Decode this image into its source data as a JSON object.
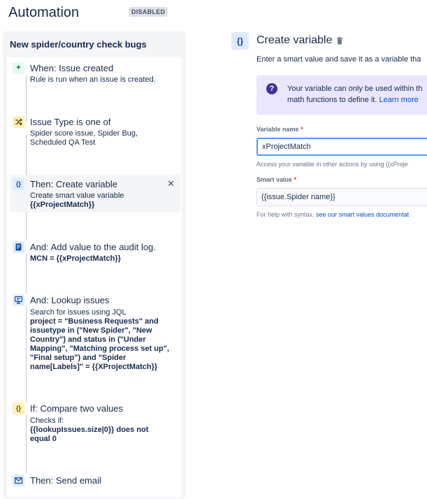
{
  "header": {
    "title": "Automation",
    "status_badge": "DISABLED"
  },
  "rule": {
    "name": "New spider/country check bugs",
    "components": [
      {
        "icon": "plus-icon",
        "title": "When: Issue created",
        "description": "Rule is run when an issue is created.",
        "bold": ""
      },
      {
        "icon": "shuffle-icon",
        "title": "Issue Type is one of",
        "description": "Spider score issue, Spider Bug, Scheduled QA Test",
        "bold": ""
      },
      {
        "icon": "braces-icon",
        "title": "Then: Create variable",
        "description": "Create smart value variable",
        "bold": "{{xProjectMatch}}",
        "selected": true
      },
      {
        "icon": "document-icon",
        "title": "And: Add value to the audit log.",
        "description": "",
        "bold": "MCN = {{xProjectMatch}}"
      },
      {
        "icon": "search-issues-icon",
        "title": "And: Lookup issues",
        "description": "Search for issues using JQL",
        "bold": "project = \"Business Requests\" and issuetype in (\"New Spider\", \"New Country\") and status in (\"Under Mapping\", \"Matching process set up\", \"Final setup\") and \"Spider name[Labels]\" = {{XProjectMatch}}"
      },
      {
        "icon": "braces-icon",
        "title": "If: Compare two values",
        "description": "Checks if:",
        "bold": "{{lookupIssues.size|0}} does not equal 0"
      },
      {
        "icon": "email-icon",
        "title": "Then: Send email",
        "description": "",
        "bold": ""
      }
    ],
    "close_symbol": "✕"
  },
  "editor": {
    "icon_glyph": "{}",
    "title": "Create variable",
    "subtitle": "Enter a smart value and save it as a variable tha",
    "info": {
      "line1": "Your variable can only be used within th",
      "line2_prefix": "math functions to define it. ",
      "line2_link": "Learn more"
    },
    "variable_name": {
      "label": "Variable name",
      "value": "xProjectMatch",
      "help": "Access your variable in other actions by using {{xProje"
    },
    "smart_value": {
      "label": "Smart value",
      "value": "{{issue.Spider name}}",
      "help_prefix": "For help with syntax, ",
      "help_link": "see our smart values documentat"
    },
    "required_mark": "*"
  },
  "colors": {
    "accent": "#0052cc",
    "info_bg": "#eae6ff",
    "focus_border": "#4c9aff"
  }
}
